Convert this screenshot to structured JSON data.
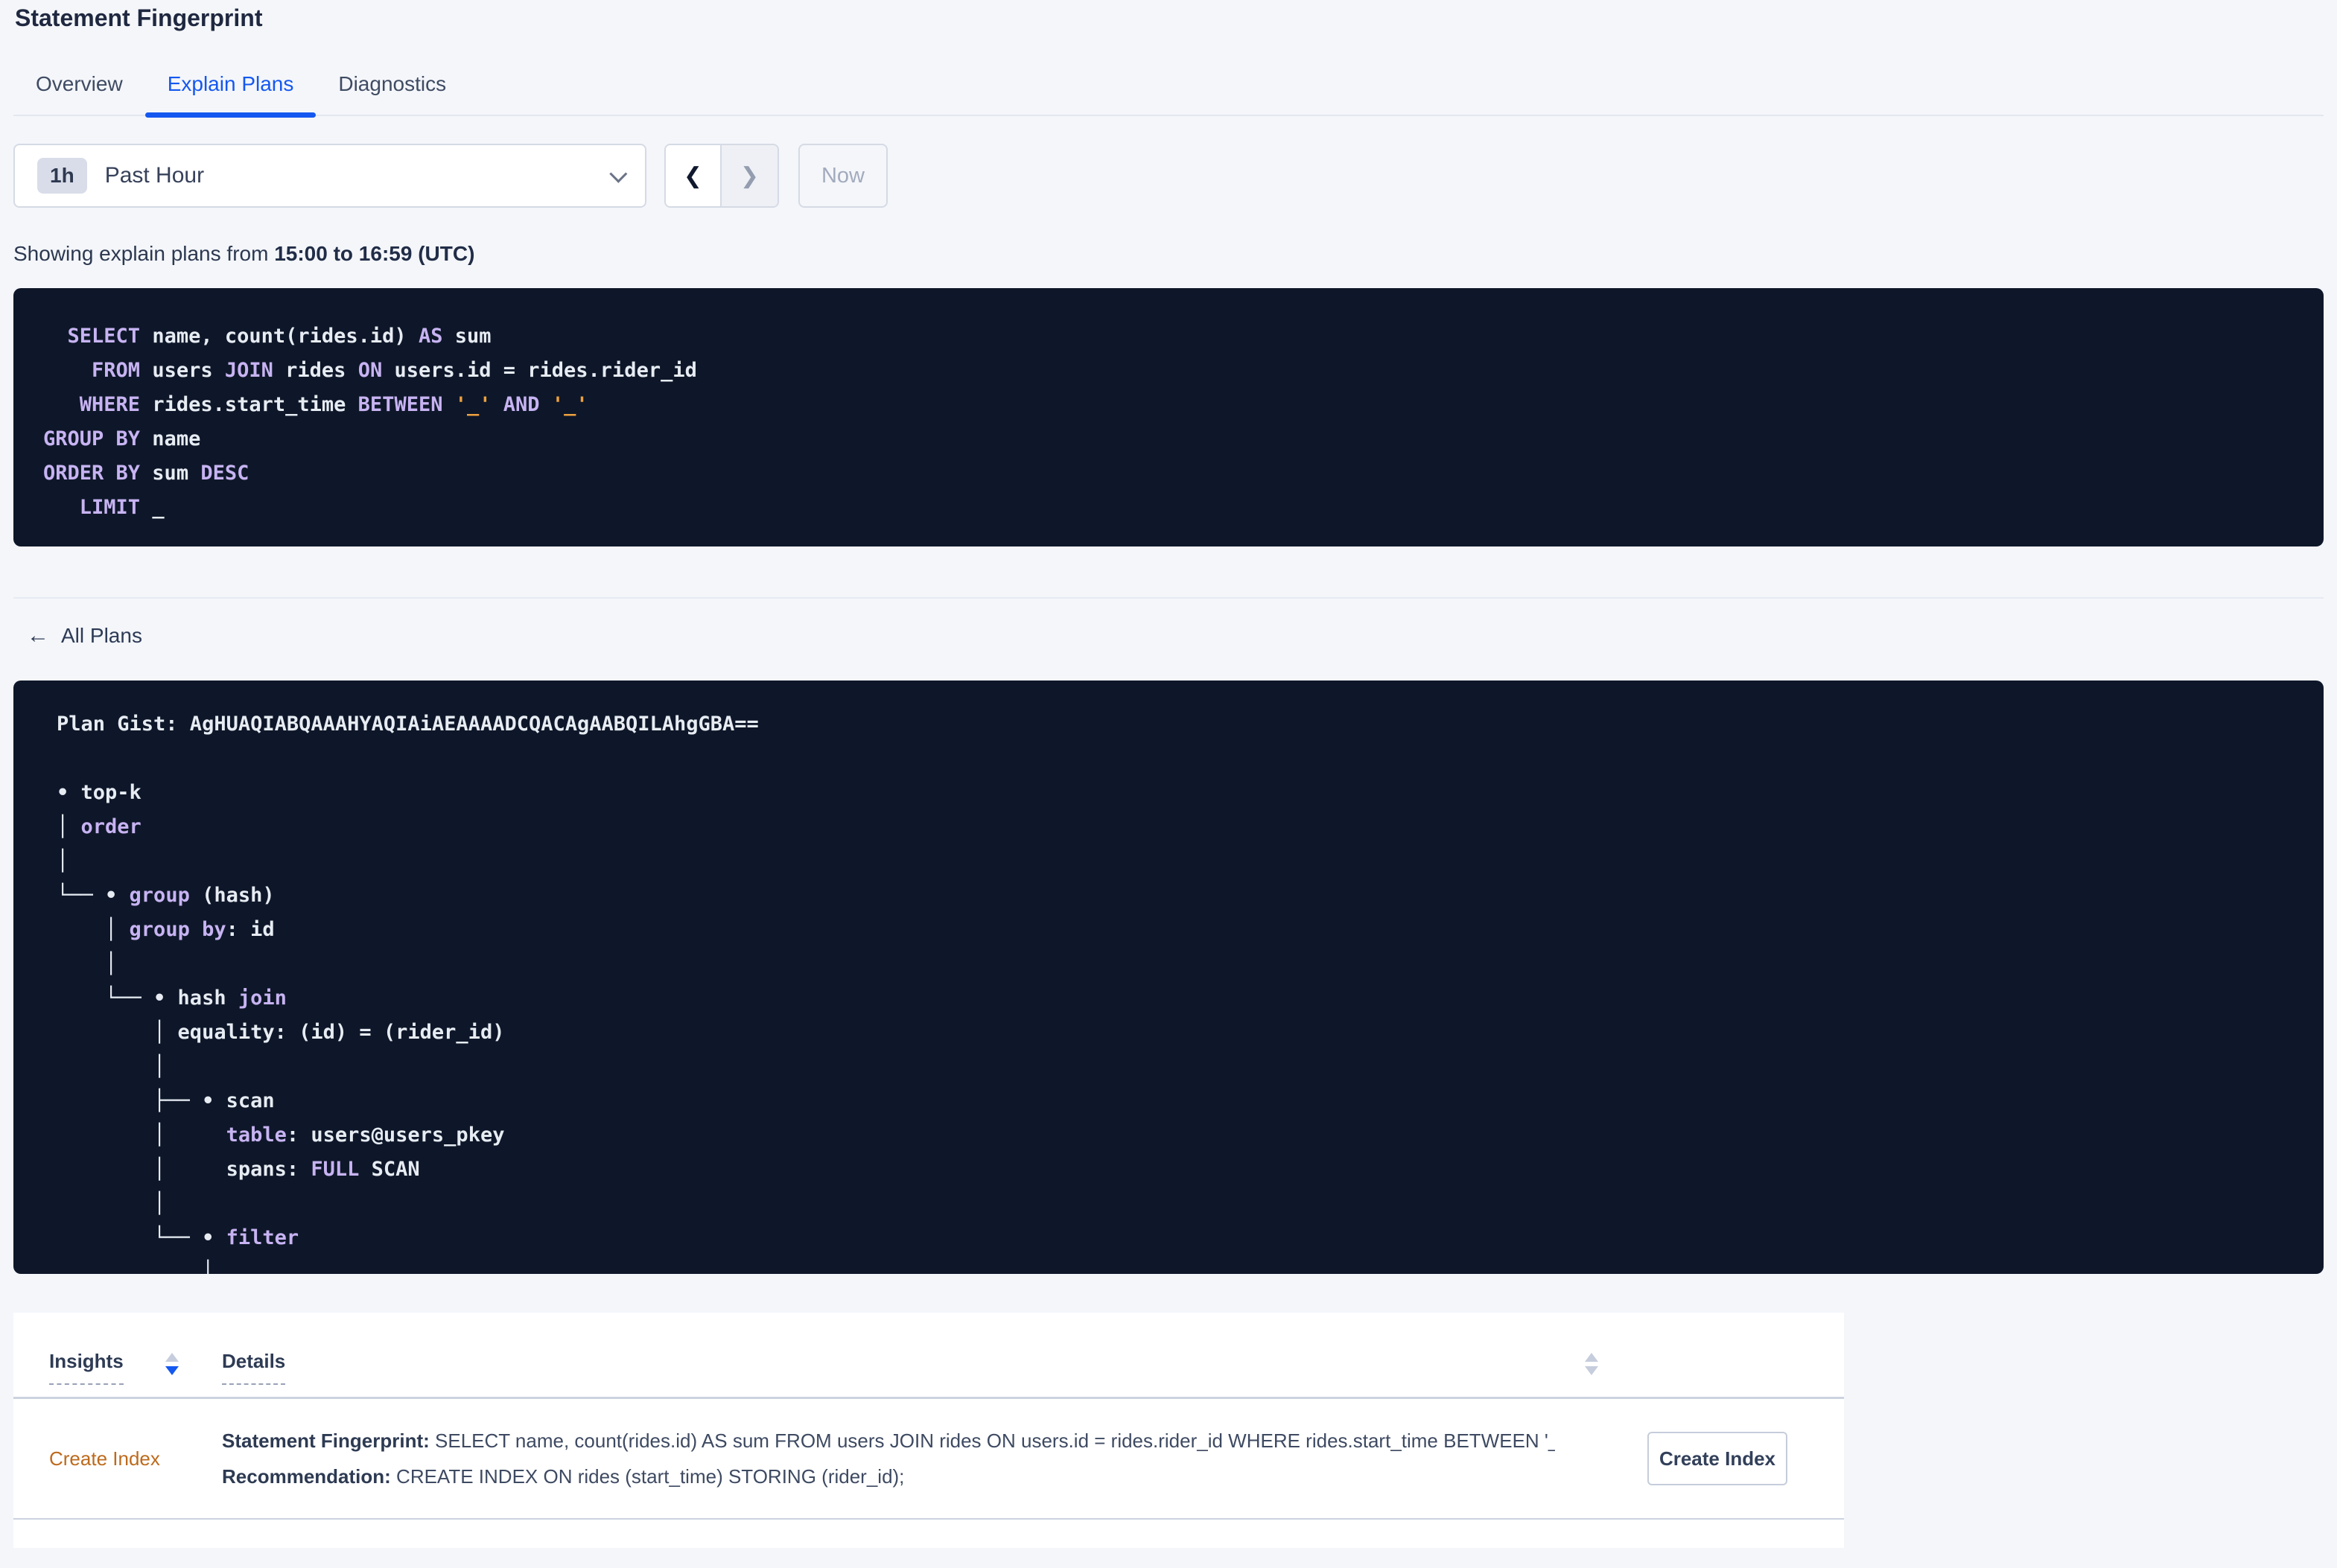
{
  "colors": {
    "accent_blue": "#1458f0",
    "code_bg": "#0e1729",
    "code_keyword": "#c7b3f2",
    "code_literal": "#eea13f",
    "code_text": "#e7ecf3",
    "insight_orange": "#bd6a1c"
  },
  "page_title": "Statement Fingerprint",
  "tabs": [
    {
      "label": "Overview",
      "active": false
    },
    {
      "label": "Explain Plans",
      "active": true
    },
    {
      "label": "Diagnostics",
      "active": false
    }
  ],
  "time_controls": {
    "range_badge": "1h",
    "range_label": "Past Hour",
    "prev_glyph": "❮",
    "next_glyph": "❯",
    "now_label": "Now"
  },
  "showing": {
    "prefix": "Showing explain plans from ",
    "range_bold": "15:00 to 16:59 (UTC)"
  },
  "sql": {
    "lines": [
      [
        {
          "t": "  "
        },
        {
          "t": "SELECT",
          "c": "kw"
        },
        {
          "t": " name, count(rides.id) "
        },
        {
          "t": "AS",
          "c": "kw"
        },
        {
          "t": " sum"
        }
      ],
      [
        {
          "t": "    "
        },
        {
          "t": "FROM",
          "c": "kw"
        },
        {
          "t": " users "
        },
        {
          "t": "JOIN",
          "c": "kw"
        },
        {
          "t": " rides "
        },
        {
          "t": "ON",
          "c": "kw"
        },
        {
          "t": " users.id = rides.rider_id"
        }
      ],
      [
        {
          "t": "   "
        },
        {
          "t": "WHERE",
          "c": "kw"
        },
        {
          "t": " rides.start_time "
        },
        {
          "t": "BETWEEN",
          "c": "kw"
        },
        {
          "t": " "
        },
        {
          "t": "'_'",
          "c": "lit"
        },
        {
          "t": " "
        },
        {
          "t": "AND",
          "c": "kw"
        },
        {
          "t": " "
        },
        {
          "t": "'_'",
          "c": "lit"
        }
      ],
      [
        {
          "t": "GROUP BY",
          "c": "kw"
        },
        {
          "t": " name"
        }
      ],
      [
        {
          "t": "ORDER BY",
          "c": "kw"
        },
        {
          "t": " sum "
        },
        {
          "t": "DESC",
          "c": "kw"
        }
      ],
      [
        {
          "t": "   "
        },
        {
          "t": "LIMIT",
          "c": "kw"
        },
        {
          "t": " _"
        }
      ]
    ]
  },
  "all_plans": {
    "arrow": "←",
    "label": "All Plans"
  },
  "plan": {
    "gist": "Plan Gist: AgHUAQIABQAAAHYAQIAiAEAAAADCQACAgAABQILAhgGBA==",
    "tree_lines": [
      [],
      [
        {
          "t": "• top-k"
        }
      ],
      [
        {
          "t": "│ "
        },
        {
          "t": "order",
          "c": "kw"
        }
      ],
      [
        {
          "t": "│"
        }
      ],
      [
        {
          "t": "└── • "
        },
        {
          "t": "group",
          "c": "kw"
        },
        {
          "t": " (hash)"
        }
      ],
      [
        {
          "t": "    │ "
        },
        {
          "t": "group by",
          "c": "kw"
        },
        {
          "t": ": id"
        }
      ],
      [
        {
          "t": "    │"
        }
      ],
      [
        {
          "t": "    └── • hash "
        },
        {
          "t": "join",
          "c": "kw"
        }
      ],
      [
        {
          "t": "        │ equality: (id) = (rider_id)"
        }
      ],
      [
        {
          "t": "        │"
        }
      ],
      [
        {
          "t": "        ├── • scan"
        }
      ],
      [
        {
          "t": "        │     "
        },
        {
          "t": "table",
          "c": "kw"
        },
        {
          "t": ": users@users_pkey"
        }
      ],
      [
        {
          "t": "        │     spans: "
        },
        {
          "t": "FULL",
          "c": "kw"
        },
        {
          "t": " SCAN"
        }
      ],
      [
        {
          "t": "        │"
        }
      ],
      [
        {
          "t": "        └── • "
        },
        {
          "t": "filter",
          "c": "kw"
        }
      ],
      [
        {
          "t": "            │"
        }
      ]
    ]
  },
  "insights_table": {
    "columns": [
      {
        "label": "Insights",
        "sort": "desc"
      },
      {
        "label": "Details",
        "sort": "none"
      }
    ],
    "rows": [
      {
        "insight": "Create Index",
        "fingerprint_label": "Statement Fingerprint:",
        "fingerprint_text": " SELECT name, count(rides.id) AS sum FROM users JOIN rides ON users.id = rides.rider_id WHERE rides.start_time BETWEEN '_…",
        "recommendation_label": "Recommendation:",
        "recommendation_text": " CREATE INDEX ON rides (start_time) STORING (rider_id);",
        "action_label": "Create Index"
      }
    ]
  }
}
